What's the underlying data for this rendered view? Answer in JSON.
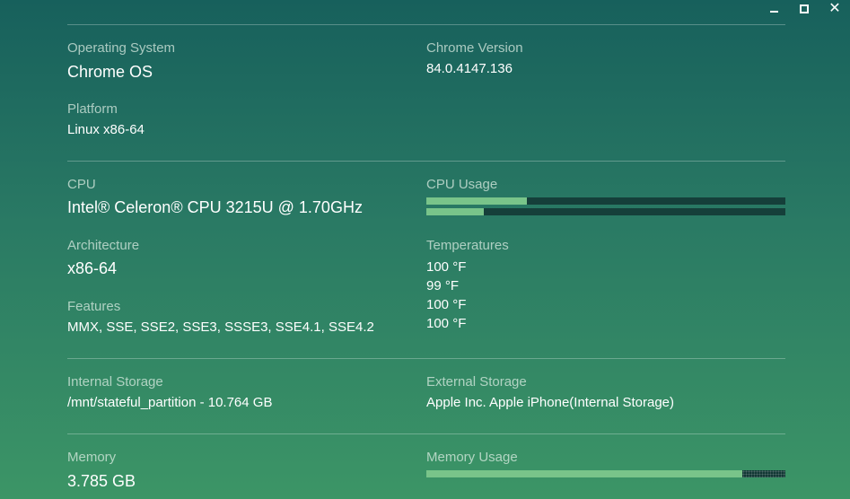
{
  "window_controls": {
    "minimize": "minimize",
    "maximize": "maximize",
    "close": "close"
  },
  "system": {
    "os_label": "Operating System",
    "os_value": "Chrome OS",
    "chrome_label": "Chrome Version",
    "chrome_value": "84.0.4147.136",
    "platform_label": "Platform",
    "platform_value": "Linux x86-64"
  },
  "cpu": {
    "cpu_label": "CPU",
    "cpu_value": "Intel® Celeron® CPU 3215U @ 1.70GHz",
    "usage_label": "CPU Usage",
    "usage_fractions": [
      0.28,
      0.16
    ],
    "arch_label": "Architecture",
    "arch_value": "x86-64",
    "temps_label": "Temperatures",
    "temps": [
      "100 °F",
      "99 °F",
      "100 °F",
      "100 °F"
    ],
    "features_label": "Features",
    "features_value": "MMX, SSE, SSE2, SSE3, SSSE3, SSE4.1, SSE4.2"
  },
  "storage": {
    "internal_label": "Internal Storage",
    "internal_value": "/mnt/stateful_partition - 10.764 GB",
    "external_label": "External Storage",
    "external_value": "Apple Inc. Apple iPhone(Internal Storage)"
  },
  "memory": {
    "memory_label": "Memory",
    "memory_value": "3.785 GB",
    "usage_label": "Memory Usage",
    "usage_fraction": 0.88
  }
}
